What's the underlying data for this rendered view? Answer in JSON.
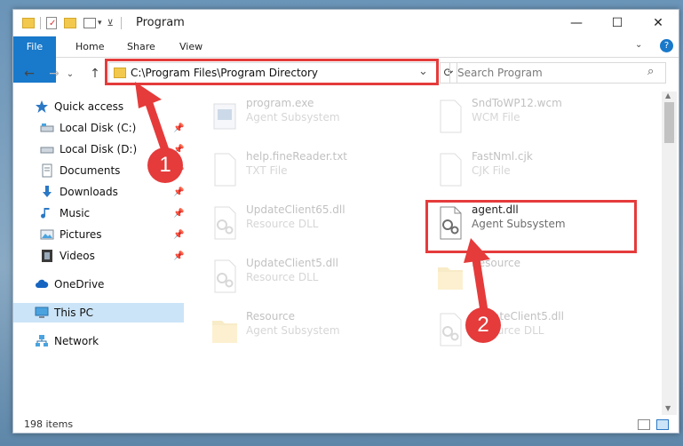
{
  "window": {
    "title": "Program",
    "minimize": "—",
    "maximize": "☐",
    "close": "✕"
  },
  "ribbon": {
    "tabs": [
      "File",
      "Home",
      "Share",
      "View"
    ],
    "help": "?"
  },
  "nav": {
    "back": "←",
    "forward": "→",
    "recent": "⌄",
    "up": "↑",
    "address_value": "C:\\Program Files\\Program Directory",
    "dropdown": "⌄",
    "refresh": "⟳",
    "search_placeholder": "Search Program",
    "search_icon": "⌕"
  },
  "sidebar": {
    "items": [
      {
        "label": "Quick access",
        "icon": "star-icon",
        "pinned": false
      },
      {
        "label": "Local Disk (C:)",
        "icon": "drive-icon",
        "pinned": true
      },
      {
        "label": "Local Disk (D:)",
        "icon": "drive-icon",
        "pinned": true
      },
      {
        "label": "Documents",
        "icon": "documents-icon",
        "pinned": true
      },
      {
        "label": "Downloads",
        "icon": "downloads-icon",
        "pinned": true
      },
      {
        "label": "Music",
        "icon": "music-icon",
        "pinned": true
      },
      {
        "label": "Pictures",
        "icon": "pictures-icon",
        "pinned": true
      },
      {
        "label": "Videos",
        "icon": "videos-icon",
        "pinned": true
      },
      {
        "label": "OneDrive",
        "icon": "onedrive-icon",
        "pinned": false
      },
      {
        "label": "This PC",
        "icon": "pc-icon",
        "pinned": false,
        "selected": true
      },
      {
        "label": "Network",
        "icon": "network-icon",
        "pinned": false
      }
    ]
  },
  "files": [
    {
      "name": "program.exe",
      "type": "Agent Subsystem",
      "icon": "exe-icon"
    },
    {
      "name": "SndToWP12.wcm",
      "type": "WCM File",
      "icon": "blank-file-icon"
    },
    {
      "name": "help.fineReader.txt",
      "type": "TXT File",
      "icon": "blank-file-icon"
    },
    {
      "name": "FastNml.cjk",
      "type": "CJK File",
      "icon": "blank-file-icon"
    },
    {
      "name": "UpdateClient65.dll",
      "type": "Resource DLL",
      "icon": "dll-icon"
    },
    {
      "name": "agent.dll",
      "type": "Agent Subsystem",
      "icon": "dll-icon"
    },
    {
      "name": "UpdateClient5.dll",
      "type": "Resource DLL",
      "icon": "dll-icon"
    },
    {
      "name": "Resource",
      "type": "",
      "icon": "folder-icon"
    },
    {
      "name": "Resource",
      "type": "Agent Subsystem",
      "icon": "folder-icon"
    },
    {
      "name": "UpdateClient5.dll",
      "type": "Resource DLL",
      "icon": "dll-icon"
    }
  ],
  "status": {
    "item_count": "198 items"
  },
  "annotations": {
    "step1": "1",
    "step2": "2",
    "color": "#e53b3b"
  }
}
